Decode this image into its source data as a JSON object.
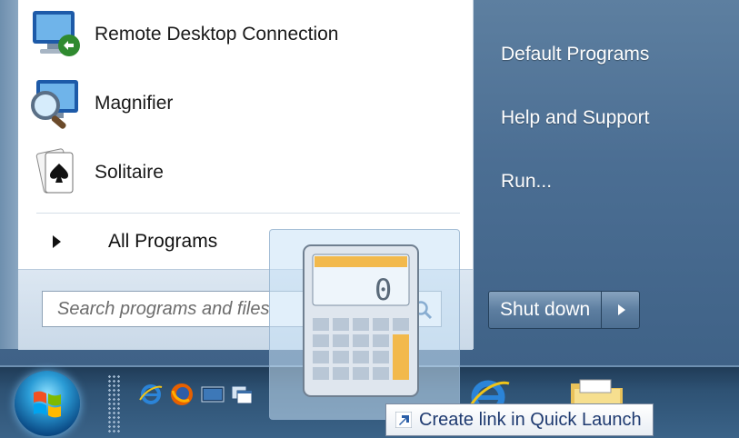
{
  "start_menu": {
    "programs": [
      {
        "label": "Remote Desktop Connection",
        "icon": "remote-desktop-icon"
      },
      {
        "label": "Magnifier",
        "icon": "magnifier-icon"
      },
      {
        "label": "Solitaire",
        "icon": "solitaire-icon"
      }
    ],
    "all_programs_label": "All Programs",
    "search": {
      "placeholder": "Search programs and files"
    },
    "right_links": [
      "Default Programs",
      "Help and Support",
      "Run..."
    ],
    "shutdown_label": "Shut down"
  },
  "drag": {
    "item_icon": "calculator-icon",
    "calculator_display": "0",
    "tooltip": "Create link in Quick Launch"
  },
  "taskbar": {
    "quick_launch": [
      "internet-explorer-icon",
      "firefox-icon",
      "show-desktop-icon",
      "switch-windows-icon"
    ],
    "pinned": [
      "internet-explorer-icon",
      "windows-explorer-icon"
    ]
  }
}
